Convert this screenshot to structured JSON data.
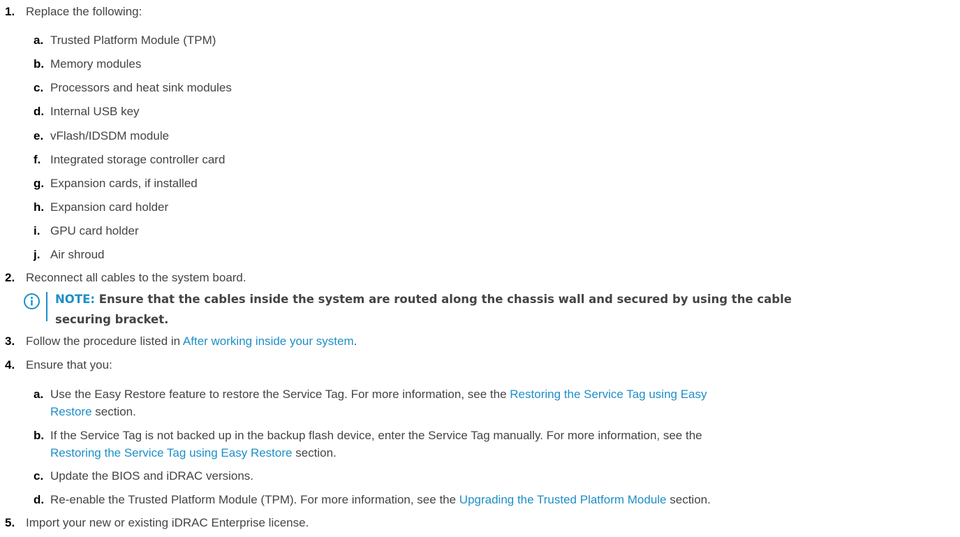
{
  "steps": [
    {
      "num": "1.",
      "text": "Replace the following:"
    },
    {
      "num": "2.",
      "text": "Reconnect all cables to the system board."
    },
    {
      "num": "3.",
      "text": "Follow the procedure listed in ",
      "link": "After working inside your system",
      "after": "."
    },
    {
      "num": "4.",
      "text": "Ensure that you:"
    },
    {
      "num": "5.",
      "text": "Import your new or existing iDRAC Enterprise license."
    }
  ],
  "replace_items": [
    {
      "letter": "a.",
      "text": "Trusted Platform Module (TPM)"
    },
    {
      "letter": "b.",
      "text": "Memory modules"
    },
    {
      "letter": "c.",
      "text": "Processors and heat sink modules"
    },
    {
      "letter": "d.",
      "text": "Internal USB key"
    },
    {
      "letter": "e.",
      "text": "vFlash/IDSDM module"
    },
    {
      "letter": "f.",
      "text": "Integrated storage controller card"
    },
    {
      "letter": "g.",
      "text": "Expansion cards, if installed"
    },
    {
      "letter": "h.",
      "text": "Expansion card holder"
    },
    {
      "letter": "i.",
      "text": "GPU card holder"
    },
    {
      "letter": "j.",
      "text": "Air shroud"
    }
  ],
  "note": {
    "label": "NOTE:",
    "line1": "Ensure that the cables inside the system are routed along the chassis wall and secured by using the cable",
    "line2": "securing bracket."
  },
  "ensure_items": [
    {
      "letter": "a.",
      "text": "Use the Easy Restore feature to restore the Service Tag. For more information, see the ",
      "link": "Restoring the Service Tag using Easy",
      "cont_link": "Restore",
      "cont_after": " section."
    },
    {
      "letter": "b.",
      "text": "If the Service Tag is not backed up in the backup flash device, enter the Service Tag manually. For more information, see the",
      "cont_link": "Restoring the Service Tag using Easy Restore",
      "cont_after": " section."
    },
    {
      "letter": "c.",
      "text": "Update the BIOS and iDRAC versions."
    },
    {
      "letter": "d.",
      "text": "Re-enable the Trusted Platform Module (TPM). For more information, see the ",
      "link": "Upgrading the Trusted Platform Module",
      "after": " section."
    }
  ],
  "colors": {
    "link": "#1d8fc7",
    "text": "#444444",
    "number": "#000000"
  },
  "icons": {
    "note": "info-icon"
  }
}
